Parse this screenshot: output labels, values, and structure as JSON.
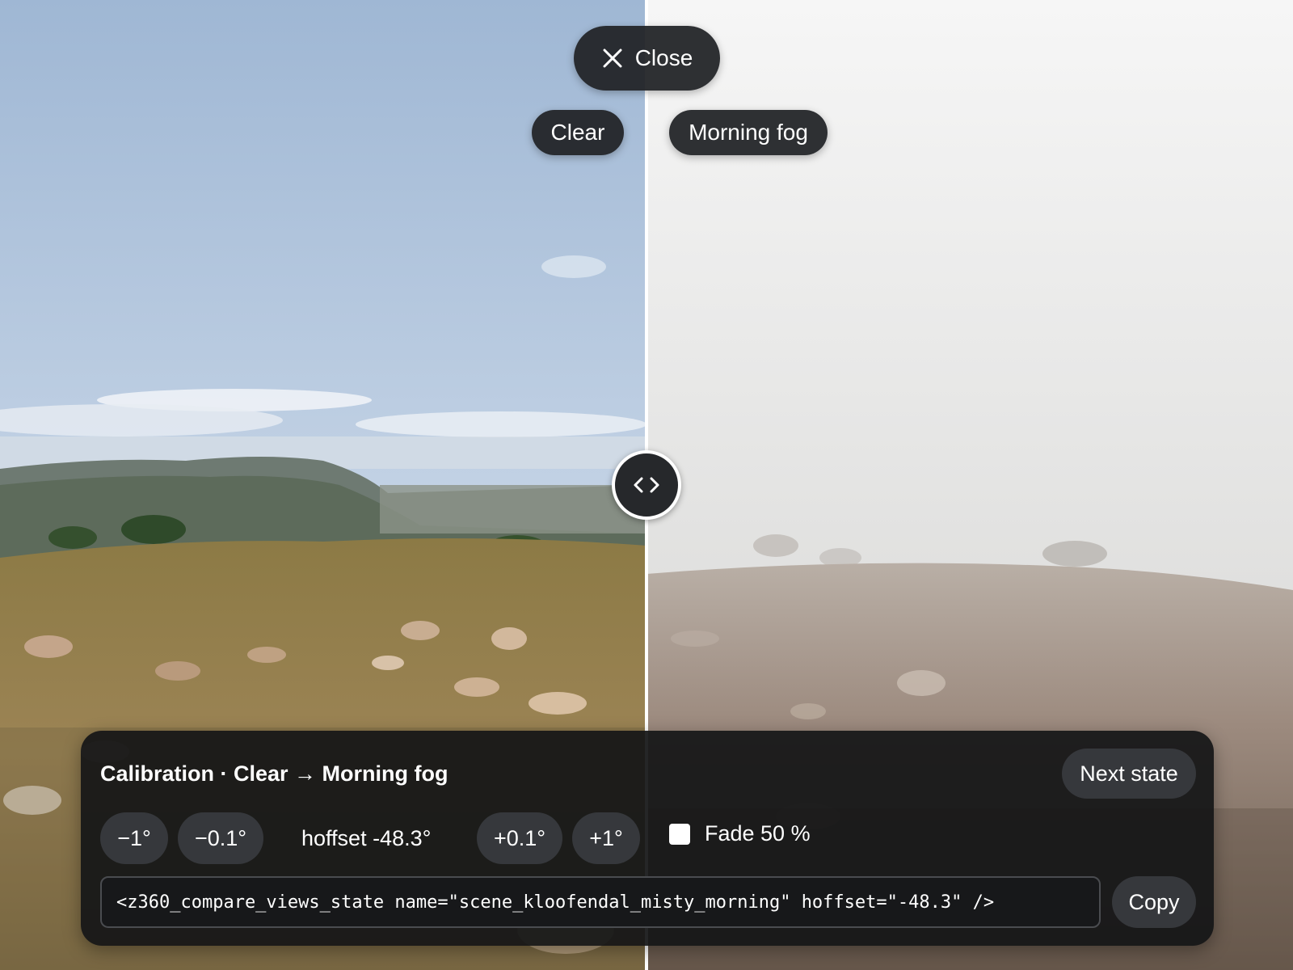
{
  "compare": {
    "close_label": "Close",
    "left_state": "Clear",
    "right_state": "Morning fog"
  },
  "panel": {
    "title": "Calibration · Clear → Morning fog",
    "next_state_label": "Next state",
    "step_minus_1": "−1°",
    "step_minus_01": "−0.1°",
    "hoffset_text": "hoffset -48.3°",
    "step_plus_01": "+0.1°",
    "step_plus_1": "+1°",
    "fade_label": "Fade 50 %",
    "code_value": "<z360_compare_views_state name=\"scene_kloofendal_misty_morning\" hoffset=\"-48.3\" />",
    "copy_label": "Copy"
  },
  "icons": {
    "close": "close-icon",
    "handle": "compare-handle-icon"
  },
  "colors": {
    "pill_bg": "#212326",
    "panel_bg": "#141517",
    "button_bg": "#36383c",
    "divider": "#ffffff"
  }
}
